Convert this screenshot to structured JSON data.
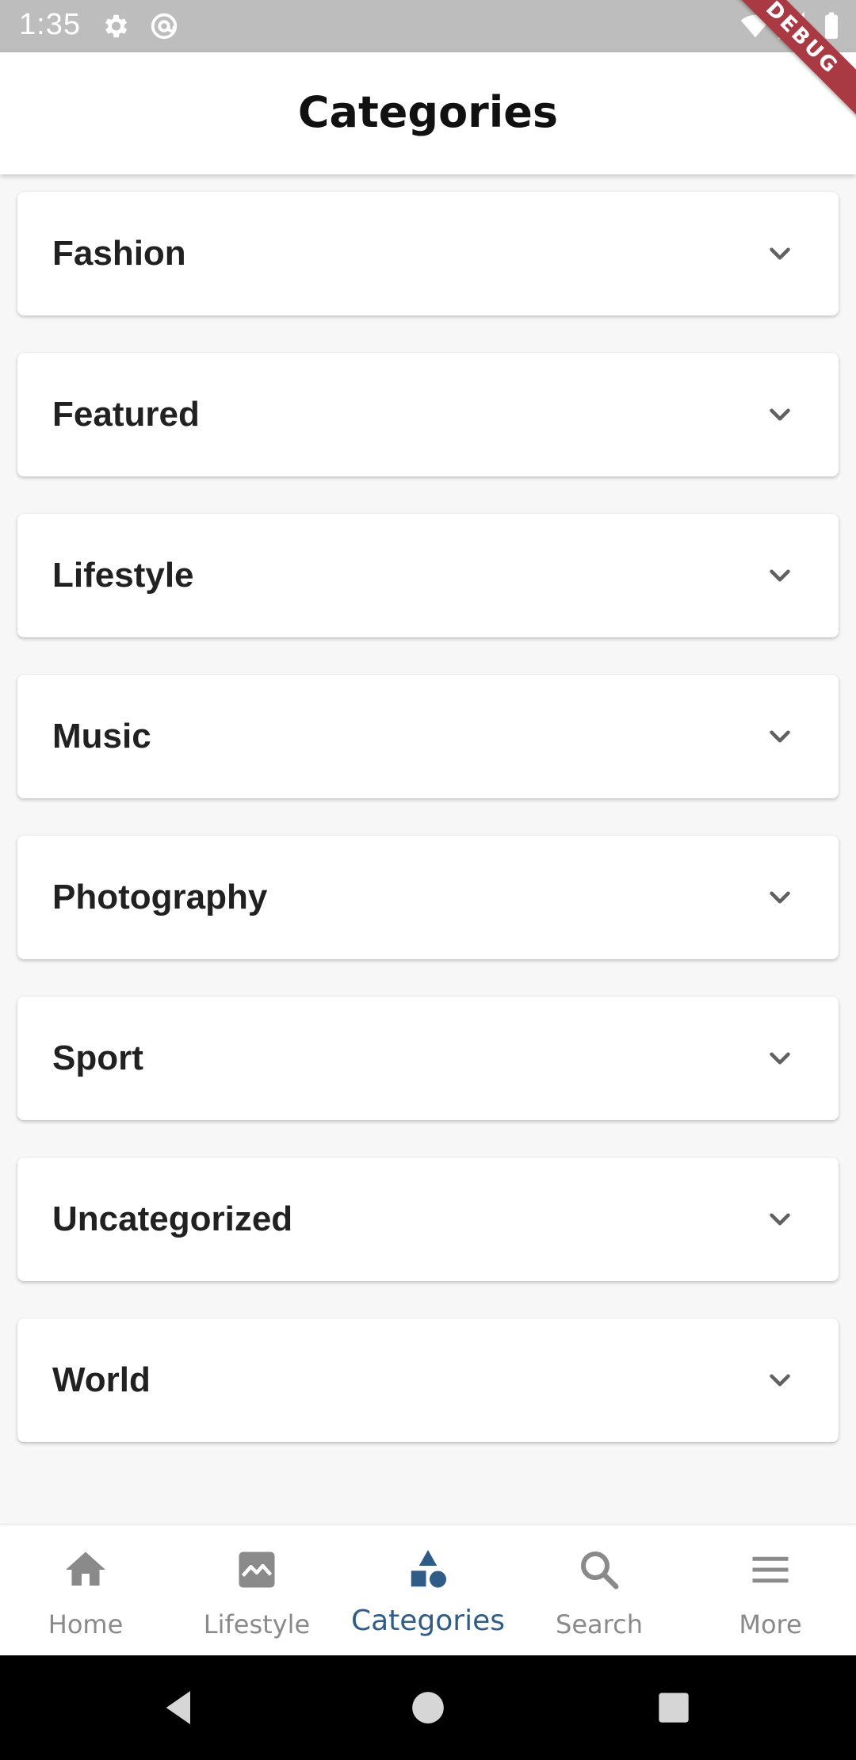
{
  "status_bar": {
    "time": "1:35",
    "icons": [
      "gear-icon",
      "at-icon",
      "wifi-icon",
      "signal-icon",
      "battery-icon"
    ],
    "debug_badge": "DEBUG"
  },
  "app_bar": {
    "title": "Categories"
  },
  "categories": [
    {
      "label": "Fashion"
    },
    {
      "label": "Featured"
    },
    {
      "label": "Lifestyle"
    },
    {
      "label": "Music"
    },
    {
      "label": "Photography"
    },
    {
      "label": "Sport"
    },
    {
      "label": "Uncategorized"
    },
    {
      "label": "World"
    }
  ],
  "bottom_nav": {
    "items": [
      {
        "label": "Home",
        "icon": "home-icon"
      },
      {
        "label": "Lifestyle",
        "icon": "image-icon"
      },
      {
        "label": "Categories",
        "icon": "shapes-icon",
        "active": true
      },
      {
        "label": "Search",
        "icon": "search-icon"
      },
      {
        "label": "More",
        "icon": "menu-icon"
      }
    ],
    "active_color": "#2f5d87",
    "inactive_color": "#8a8a8a"
  },
  "system_nav": {
    "buttons": [
      "back-icon",
      "home-circle-icon",
      "recents-icon"
    ]
  }
}
